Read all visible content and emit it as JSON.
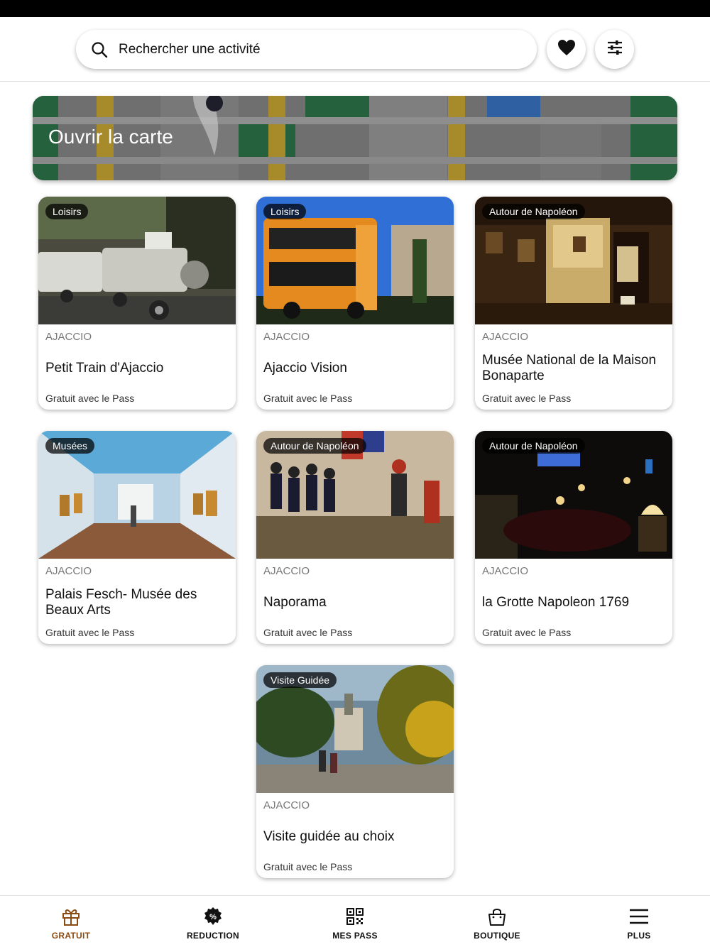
{
  "search": {
    "placeholder": "Rechercher une activité",
    "value": ""
  },
  "map_banner": {
    "label": "Ouvrir la carte"
  },
  "cards": [
    {
      "tag": "Loisirs",
      "city": "AJACCIO",
      "title": "Petit Train d'Ajaccio",
      "price": "Gratuit avec le Pass"
    },
    {
      "tag": "Loisirs",
      "city": "AJACCIO",
      "title": "Ajaccio Vision",
      "price": "Gratuit avec le Pass"
    },
    {
      "tag": "Autour de Napoléon",
      "city": "AJACCIO",
      "title": "Musée National de la Maison Bonaparte",
      "price": "Gratuit avec le Pass"
    },
    {
      "tag": "Musées",
      "city": "AJACCIO",
      "title": "Palais Fesch- Musée des Beaux Arts",
      "price": "Gratuit avec le Pass"
    },
    {
      "tag": "Autour de Napoléon",
      "city": "AJACCIO",
      "title": "Naporama",
      "price": "Gratuit avec le Pass"
    },
    {
      "tag": "Autour de Napoléon",
      "city": "AJACCIO",
      "title": "la Grotte Napoleon 1769",
      "price": "Gratuit avec le Pass"
    },
    {
      "tag": "Visite Guidée",
      "city": "AJACCIO",
      "title": "Visite guidée  au choix",
      "price": "Gratuit avec le Pass"
    }
  ],
  "nav": {
    "items": [
      {
        "label": "GRATUIT",
        "icon": "gift-icon",
        "active": true
      },
      {
        "label": "REDUCTION",
        "icon": "percent-badge-icon",
        "active": false
      },
      {
        "label": "MES PASS",
        "icon": "qr-code-icon",
        "active": false
      },
      {
        "label": "BOUTIQUE",
        "icon": "shopping-bag-icon",
        "active": false
      },
      {
        "label": "PLUS",
        "icon": "menu-icon",
        "active": false
      }
    ]
  },
  "colors": {
    "accent": "#8b4a12",
    "map_green": "#2f7d4e",
    "map_yellow": "#d7b236",
    "map_blue": "#3d7bd0"
  }
}
